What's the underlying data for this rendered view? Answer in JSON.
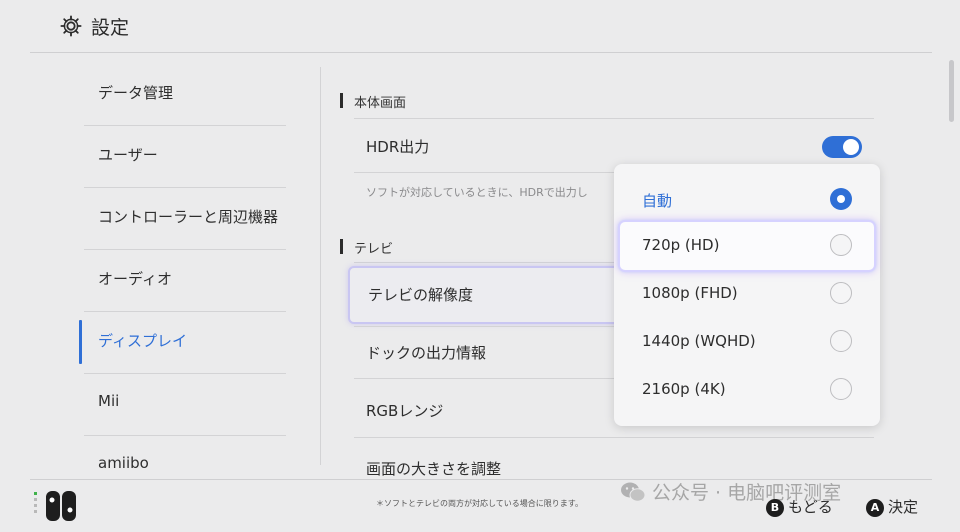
{
  "header": {
    "title": "設定",
    "icon": "gear-icon"
  },
  "sidebar": {
    "items": [
      {
        "label": "データ管理"
      },
      {
        "label": "ユーザー"
      },
      {
        "label": "コントローラーと周辺機器"
      },
      {
        "label": "オーディオ"
      },
      {
        "label": "ディスプレイ",
        "selected": true
      },
      {
        "label": "Mii"
      },
      {
        "label": "amiibo"
      }
    ]
  },
  "main": {
    "section_body": "本体画面",
    "hdr_label": "HDR出力",
    "hdr_enabled": true,
    "hdr_desc": "ソフトが対応しているときに、HDRで出力し",
    "section_tv": "テレビ",
    "rows": [
      {
        "label": "テレビの解像度"
      },
      {
        "label": "ドックの出力情報"
      },
      {
        "label": "RGBレンジ"
      },
      {
        "label": "画面の大きさを調整"
      }
    ]
  },
  "popup": {
    "options": [
      {
        "label": "自動",
        "selected": true
      },
      {
        "label": "720p (HD)",
        "focused": true
      },
      {
        "label": "1080p (FHD)"
      },
      {
        "label": "1440p (WQHD)"
      },
      {
        "label": "2160p (4K)"
      }
    ]
  },
  "footer": {
    "footnote": "＊ソフトとテレビの両方が対応している場合に限ります。",
    "watermark": "公众号 · 电脑吧评测室",
    "back_key": "B",
    "back_label": "もどる",
    "ok_key": "A",
    "ok_label": "決定"
  },
  "colors": {
    "accent": "#2f6fd6",
    "background": "#ebebec",
    "text": "#2d2d2d"
  }
}
